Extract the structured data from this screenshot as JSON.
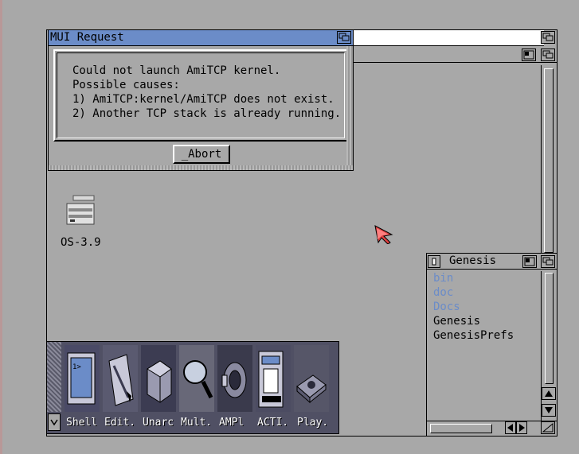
{
  "request": {
    "title": "MUI Request",
    "message": [
      "Could not launch AmiTCP kernel.",
      "Possible causes:",
      "1) AmiTCP:kernel/AmiTCP does not exist.",
      "2) Another TCP stack is already running."
    ],
    "abort_label": "_Abort"
  },
  "desktop": {
    "drive_label": "OS-3.9"
  },
  "genesis": {
    "title": "Genesis",
    "items": [
      {
        "label": "bin",
        "kind": "drawer"
      },
      {
        "label": "doc",
        "kind": "drawer"
      },
      {
        "label": "Docs",
        "kind": "drawer"
      },
      {
        "label": "Genesis",
        "kind": "file"
      },
      {
        "label": "GenesisPrefs",
        "kind": "file"
      }
    ]
  },
  "dock": {
    "items": [
      {
        "label": "Shell",
        "icon": "shell-icon"
      },
      {
        "label": "Edit.",
        "icon": "edit-icon"
      },
      {
        "label": "Unarc",
        "icon": "unarc-icon"
      },
      {
        "label": "Mult.",
        "icon": "magnifier-icon"
      },
      {
        "label": "AMPl",
        "icon": "speaker-icon"
      },
      {
        "label": "ACTI.",
        "icon": "terminal-icon"
      },
      {
        "label": "Play.",
        "icon": "player-icon"
      }
    ]
  },
  "colors": {
    "titlebar_active": "#6b8cc8",
    "drawer_text": "#6b8cc8",
    "background": "#a8a8a8"
  }
}
